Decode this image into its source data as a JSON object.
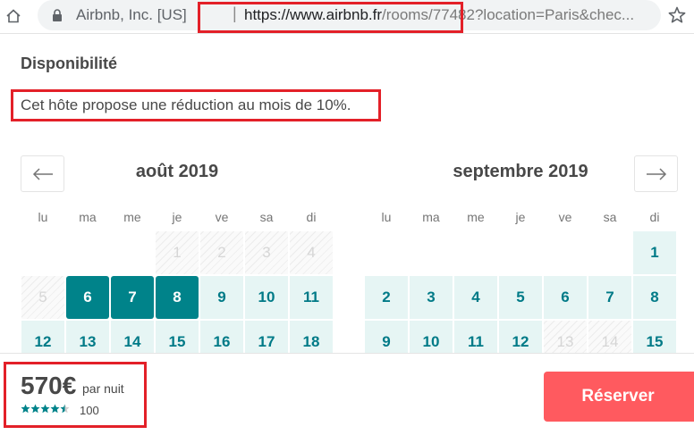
{
  "browser": {
    "site_identity": "Airbnb, Inc. [US]",
    "separator": "|",
    "url_host": "https://www.airbnb.fr",
    "url_path": "/rooms/77482?location=Paris&chec..."
  },
  "availability": {
    "title": "Disponibilité",
    "discount_text": "Cet hôte propose une réduction au mois de 10%."
  },
  "calendar": {
    "weekdays": [
      "lu",
      "ma",
      "me",
      "je",
      "ve",
      "sa",
      "di"
    ],
    "months": [
      {
        "title": "août 2019",
        "days": [
          {
            "label": "1",
            "state": "blocked"
          },
          {
            "label": "2",
            "state": "blocked"
          },
          {
            "label": "3",
            "state": "blocked"
          },
          {
            "label": "4",
            "state": "blocked"
          },
          {
            "label": "5",
            "state": "blocked"
          },
          {
            "label": "6",
            "state": "selected"
          },
          {
            "label": "7",
            "state": "selected"
          },
          {
            "label": "8",
            "state": "selected"
          },
          {
            "label": "9",
            "state": "available"
          },
          {
            "label": "10",
            "state": "available"
          },
          {
            "label": "11",
            "state": "available"
          },
          {
            "label": "12",
            "state": "available"
          },
          {
            "label": "13",
            "state": "available"
          },
          {
            "label": "14",
            "state": "available"
          },
          {
            "label": "15",
            "state": "available"
          },
          {
            "label": "16",
            "state": "available"
          },
          {
            "label": "17",
            "state": "available"
          },
          {
            "label": "18",
            "state": "available"
          }
        ]
      },
      {
        "title": "septembre 2019",
        "days": [
          {
            "label": "1",
            "state": "available"
          },
          {
            "label": "2",
            "state": "available"
          },
          {
            "label": "3",
            "state": "available"
          },
          {
            "label": "4",
            "state": "available"
          },
          {
            "label": "5",
            "state": "available"
          },
          {
            "label": "6",
            "state": "available"
          },
          {
            "label": "7",
            "state": "available"
          },
          {
            "label": "8",
            "state": "available"
          },
          {
            "label": "9",
            "state": "available"
          },
          {
            "label": "10",
            "state": "available"
          },
          {
            "label": "11",
            "state": "available"
          },
          {
            "label": "12",
            "state": "available"
          },
          {
            "label": "13",
            "state": "blocked"
          },
          {
            "label": "14",
            "state": "blocked"
          },
          {
            "label": "15",
            "state": "available"
          }
        ]
      }
    ]
  },
  "booking": {
    "price": "570€",
    "per_night": "par nuit",
    "rating_stars": 4.5,
    "review_count": "100",
    "reserve_label": "Réserver"
  },
  "colors": {
    "selected": "#00838a",
    "available_bg": "#e6f5f4",
    "available_text": "#007a87",
    "reserve": "#ff5a5f",
    "highlight": "#e32028"
  },
  "icons": {
    "home": "home-icon",
    "lock": "lock-icon",
    "bookmark": "star-icon",
    "prev": "arrow-left-icon",
    "next": "arrow-right-icon"
  }
}
